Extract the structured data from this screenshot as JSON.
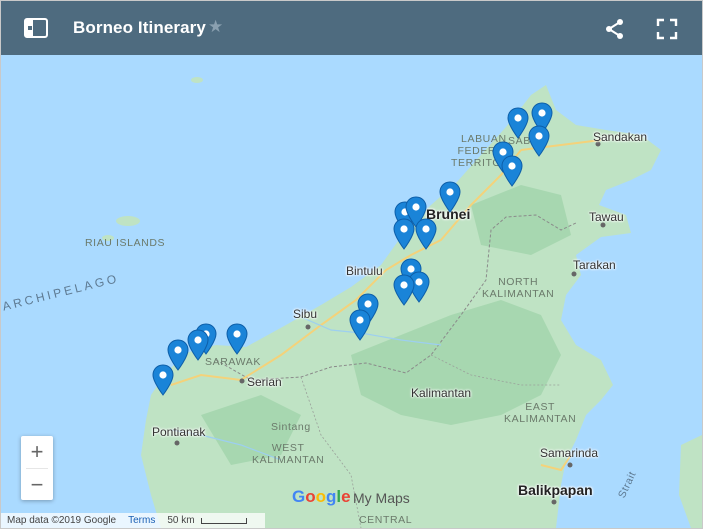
{
  "header": {
    "title": "Borneo Itinerary",
    "star": "★",
    "menu_icon": "map-legend-icon",
    "share_icon": "share-icon",
    "fullscreen_icon": "fullscreen-icon"
  },
  "map": {
    "place_labels": {
      "sandakan": "Sandakan",
      "tawau": "Tawau",
      "tarakan": "Tarakan",
      "bintulu": "Bintulu",
      "sibu": "Sibu",
      "serian": "Serian",
      "kalimantan": "Kalimantan",
      "pontianak": "Pontianak",
      "sintang": "Sintang",
      "samarinda": "Samarinda",
      "balikpapan": "Balikpapan",
      "brunei": "Brunei",
      "sabah": "SABAH"
    },
    "region_labels": {
      "labuan": "LABUAN\nFEDERAL\nTERRITORY",
      "riau": "RIAU ISLANDS",
      "north_kalimantan": "NORTH\nKALIMANTAN",
      "east_kalimantan": "EAST\nKALIMANTAN",
      "west_kalimantan": "WEST\nKALIMANTAN",
      "central_kalimantan": "CENTRAL",
      "sarawak": "SARAWAK",
      "archipelago": "ARCHIPELAGO",
      "strait": "Strait"
    },
    "pin_color": "#1a84d8",
    "pin_count": 27
  },
  "zoom": {
    "in": "+",
    "out": "−"
  },
  "footer": {
    "brand_google": [
      "G",
      "o",
      "o",
      "g",
      "l",
      "e"
    ],
    "brand_google_colors": [
      "#4285f4",
      "#ea4335",
      "#fbbc05",
      "#4285f4",
      "#34a853",
      "#ea4335"
    ],
    "brand_mymaps": "My Maps",
    "map_data": "Map data ©2019 Google",
    "terms": "Terms",
    "scale": "50 km"
  },
  "colors": {
    "header": "#4e6b7f",
    "sea": "#aadaff",
    "land": "#bfe3c4",
    "land_dark": "#a7d7b0"
  }
}
